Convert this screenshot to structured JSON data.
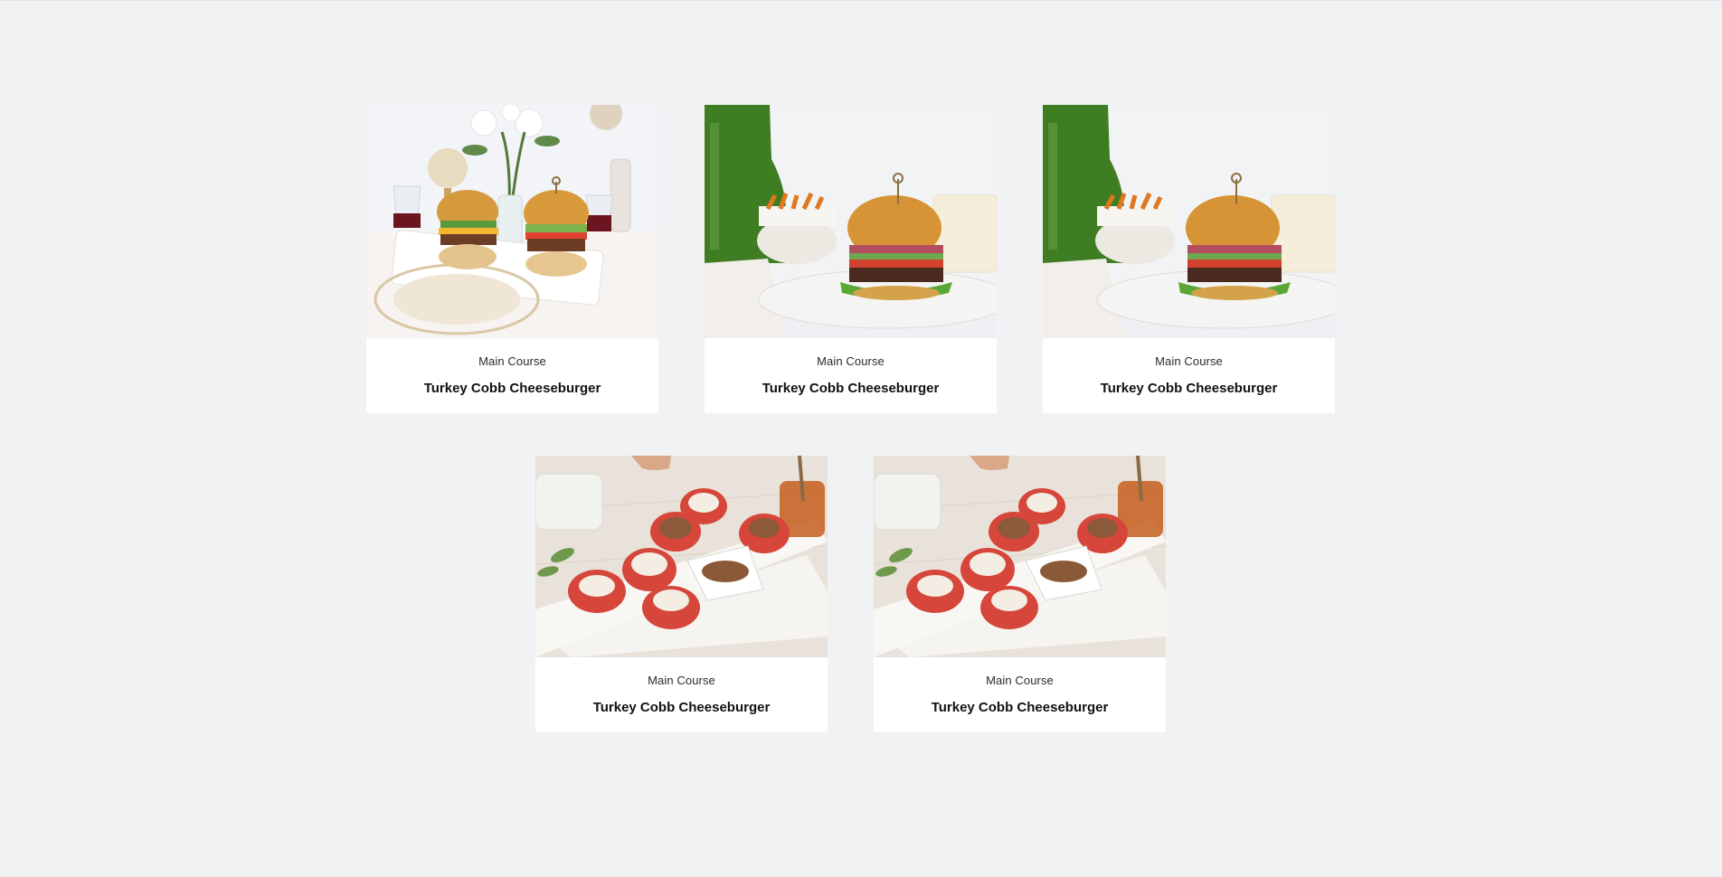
{
  "cards": [
    {
      "category": "Main Course",
      "title": "Turkey Cobb Cheeseburger",
      "image": "two-burgers-table-photo"
    },
    {
      "category": "Main Course",
      "title": "Turkey Cobb Cheeseburger",
      "image": "burger-plate-bottle-photo"
    },
    {
      "category": "Main Course",
      "title": "Turkey Cobb Cheeseburger",
      "image": "burger-plate-bottle-photo"
    },
    {
      "category": "Main Course",
      "title": "Turkey Cobb Cheeseburger",
      "image": "grilled-peaches-board-photo"
    },
    {
      "category": "Main Course",
      "title": "Turkey Cobb Cheeseburger",
      "image": "grilled-peaches-board-photo"
    }
  ]
}
